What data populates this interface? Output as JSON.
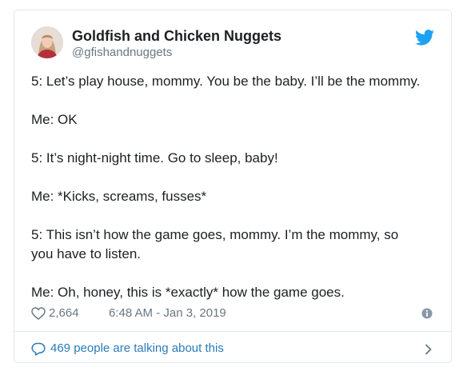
{
  "author": {
    "display_name": "Goldfish and Chicken Nuggets",
    "handle": "@gfishandnuggets",
    "avatar_icon": "profile-photo"
  },
  "tweet": {
    "lines": [
      "5: Let’s play house, mommy. You be the baby. I’ll be the mommy.",
      "",
      "Me: OK",
      "",
      "5: It’s night-night time. Go to sleep, baby!",
      "",
      "Me: *Kicks, screams, fusses*",
      "",
      "5: This isn’t how the game goes, mommy. I’m the mommy, so",
      "you have to listen.",
      "",
      "Me: Oh, honey, this is *exactly* how the game goes."
    ]
  },
  "meta": {
    "likes": "2,664",
    "timestamp": "6:48 AM - Jan 3, 2019",
    "info_icon": "info-icon"
  },
  "footer": {
    "text": "469 people are talking about this"
  },
  "colors": {
    "twitter_blue": "#1da1f2",
    "link_blue": "#2b7bb9",
    "muted": "#697882",
    "text": "#1c2022",
    "border": "#e1e8ed"
  }
}
